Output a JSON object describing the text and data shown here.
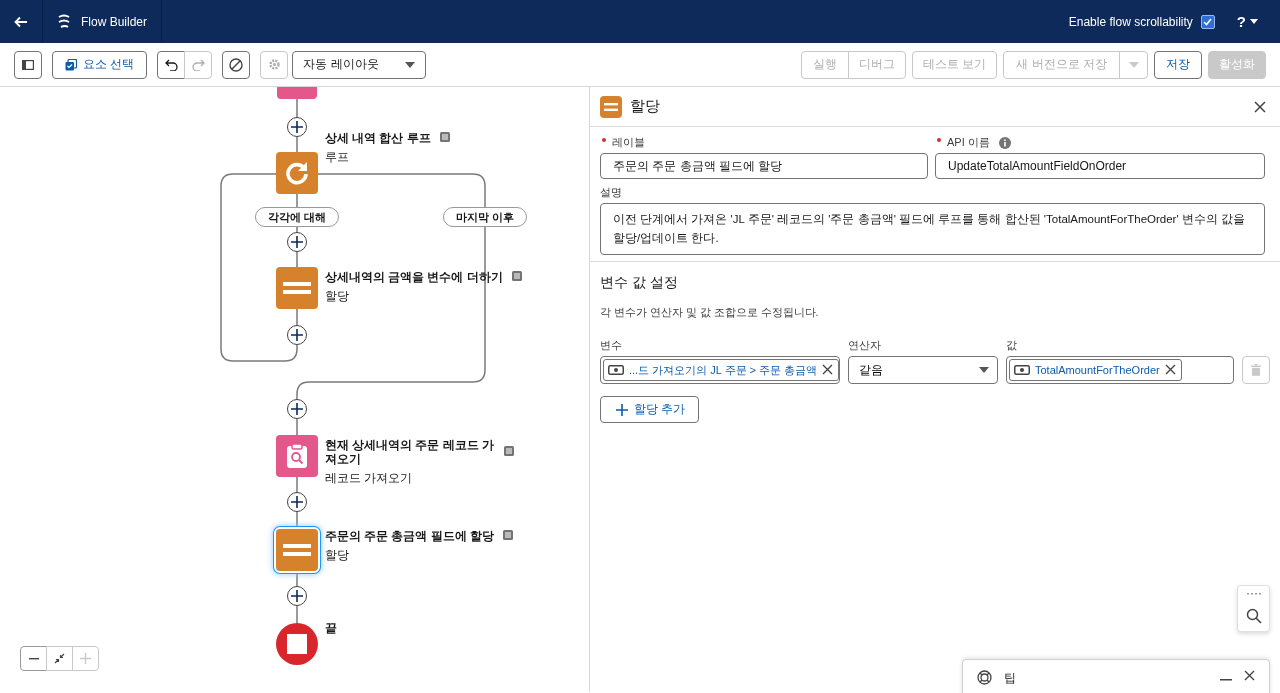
{
  "header": {
    "title": "Flow Builder",
    "scroll_toggle": {
      "label": "Enable flow scrollability",
      "checked": true
    },
    "help": "?"
  },
  "toolbar": {
    "select_button": "요소 선택",
    "undo_disabled": false,
    "redo_disabled": true,
    "settings_disabled": true,
    "layout_dropdown": "자동 레이아웃",
    "actions": [
      {
        "label": "실행",
        "kind": "first",
        "disabled": true
      },
      {
        "label": "디버그",
        "kind": "last",
        "disabled": true
      },
      {
        "label": "테스트 보기",
        "kind": "single",
        "disabled": true
      },
      {
        "label": "새 버전으로 저장",
        "kind": "split",
        "disabled": true
      },
      {
        "label": "저장",
        "kind": "single",
        "disabled": false
      },
      {
        "label": "활성화",
        "kind": "brand",
        "disabled": true
      }
    ]
  },
  "canvas": {
    "nodes": [
      {
        "kind": "loop",
        "title": "상세 내역 합산 루프",
        "type": "루프",
        "selected": false
      },
      {
        "kind": "assignment",
        "title": "상세내역의 금액을 변수에 더하기",
        "type": "할당",
        "selected": false
      },
      {
        "kind": "get-records",
        "title": "현재 상세내역의 주문 레코드 가져오기",
        "type": "레코드 가져오기",
        "selected": false
      },
      {
        "kind": "assignment",
        "title": "주문의 주문 총금액 필드에 할당",
        "type": "할당",
        "selected": true
      }
    ],
    "branches": [
      "각각에 대해",
      "마지막 이후"
    ],
    "end": {
      "label": "끝"
    }
  },
  "panel": {
    "title": "할당",
    "label_field": {
      "label": "레이블",
      "required": true,
      "value": "주문의 주문 총금액 필드에 할당"
    },
    "api_field": {
      "label": "API 이름",
      "required": true,
      "value": "UpdateTotalAmountFieldOnOrder"
    },
    "description": {
      "label": "설명",
      "value": "이전 단계에서 가져온 'JL 주문' 레코드의 '주문 총금액' 필드에 루프를 통해 합산된 'TotalAmountForTheOrder' 변수의 값을 할당/업데이트 한다."
    },
    "section_title": "변수 값 설정",
    "section_hint": "각 변수가 연산자 및 값 조합으로 수정됩니다.",
    "columns": [
      "변수",
      "연산자",
      "값"
    ],
    "assignments": [
      {
        "variable": "...드 가져오기의 JL 주문 > 주문 총금액",
        "operator": "같음",
        "value": "TotalAmountForTheOrder",
        "delete_disabled": true
      }
    ],
    "add_button": "할당 추가"
  },
  "tips": {
    "title": "팁"
  }
}
